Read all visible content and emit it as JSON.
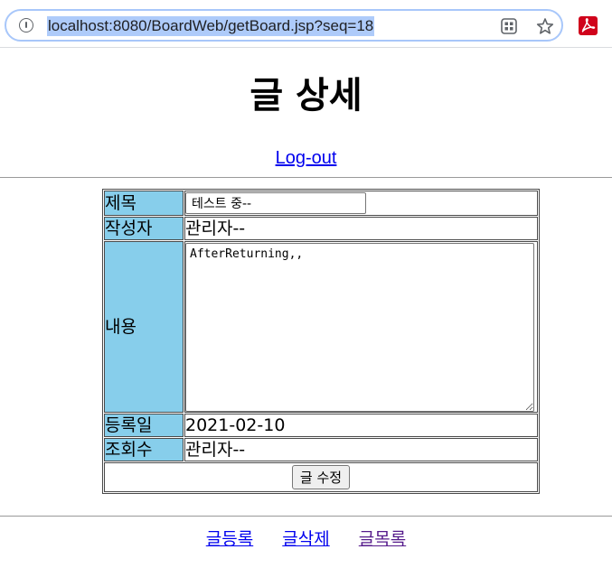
{
  "browser": {
    "url": "localhost:8080/BoardWeb/getBoard.jsp?seq=18",
    "icons": [
      "info-icon",
      "apps-icon",
      "star-icon",
      "pdf-icon"
    ],
    "colors": {
      "selection": "#aecbfa",
      "omnibox_border": "#a8c7fa",
      "pdf": "#d0021b"
    }
  },
  "page": {
    "title": "글 상세",
    "logout": "Log-out"
  },
  "form": {
    "rows": {
      "title_label": "제목",
      "title_value": "테스트 중--",
      "writer_label": "작성자",
      "writer_value": "관리자--",
      "content_label": "내용",
      "content_value": "AfterReturning,,",
      "date_label": "등록일",
      "date_value": "2021-02-10",
      "views_label": "조회수",
      "views_value": "관리자--"
    },
    "submit_label": "글 수정",
    "label_bg": "#87ceeb"
  },
  "footer": {
    "insert": "글등록",
    "delete": "글삭제",
    "list": "글목록"
  }
}
